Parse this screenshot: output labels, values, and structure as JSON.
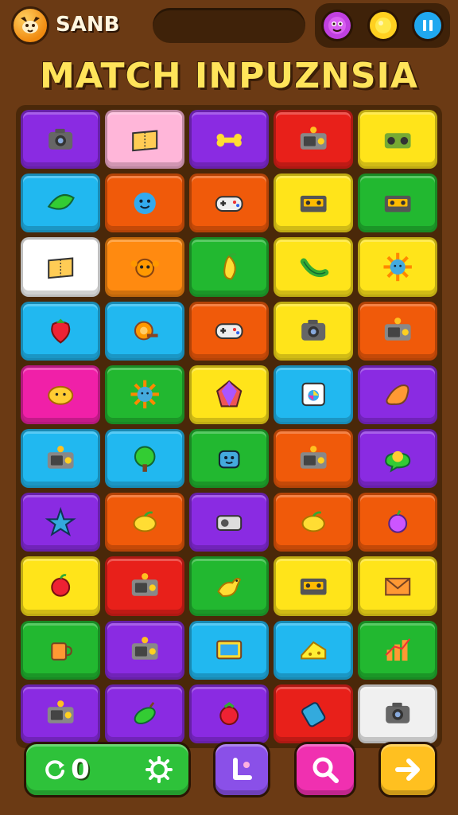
{
  "header": {
    "player_name": "SANB",
    "title": "MATCH INPUZNSIA",
    "icons": [
      "fox-logo-icon",
      "purple-creature-icon",
      "yellow-coin-icon",
      "pause-icon"
    ]
  },
  "board": {
    "tiles": [
      {
        "color": "#8a2be2",
        "icon": "camera-icon"
      },
      {
        "color": "#ffb6d9",
        "icon": "ticket-icon"
      },
      {
        "color": "#8a2be2",
        "icon": "bone-icon"
      },
      {
        "color": "#e8201a",
        "icon": "radio-icon"
      },
      {
        "color": "#ffe41a",
        "icon": "boombox-icon"
      },
      {
        "color": "#21b8f0",
        "icon": "leaf-icon"
      },
      {
        "color": "#f05a0a",
        "icon": "smiley-ball-icon"
      },
      {
        "color": "#f05a0a",
        "icon": "gamepad-icon"
      },
      {
        "color": "#ffe41a",
        "icon": "cassette-icon"
      },
      {
        "color": "#22b830",
        "icon": "cassette-icon"
      },
      {
        "color": "#ffffff",
        "icon": "ticket-icon"
      },
      {
        "color": "#ff8a10",
        "icon": "crab-icon"
      },
      {
        "color": "#22b830",
        "icon": "mango-icon"
      },
      {
        "color": "#ffe41a",
        "icon": "cucumber-icon"
      },
      {
        "color": "#ffe41a",
        "icon": "sun-face-icon"
      },
      {
        "color": "#21b8f0",
        "icon": "strawberry-icon"
      },
      {
        "color": "#21b8f0",
        "icon": "gear-icon"
      },
      {
        "color": "#f05a0a",
        "icon": "gamepad-icon"
      },
      {
        "color": "#ffe41a",
        "icon": "camera-icon"
      },
      {
        "color": "#f05a0a",
        "icon": "radio-icon"
      },
      {
        "color": "#f020a8",
        "icon": "smiley-bun-icon"
      },
      {
        "color": "#22b830",
        "icon": "sun-face-icon"
      },
      {
        "color": "#ffe41a",
        "icon": "gem-icon"
      },
      {
        "color": "#21b8f0",
        "icon": "photo-frame-icon"
      },
      {
        "color": "#8a2be2",
        "icon": "splat-icon"
      },
      {
        "color": "#21b8f0",
        "icon": "radio-icon"
      },
      {
        "color": "#21b8f0",
        "icon": "tree-icon"
      },
      {
        "color": "#22b830",
        "icon": "robot-icon"
      },
      {
        "color": "#f05a0a",
        "icon": "radio-icon"
      },
      {
        "color": "#8a2be2",
        "icon": "speech-ball-icon"
      },
      {
        "color": "#8a2be2",
        "icon": "star-icon"
      },
      {
        "color": "#f05a0a",
        "icon": "lemon-icon"
      },
      {
        "color": "#8a2be2",
        "icon": "projector-icon"
      },
      {
        "color": "#f05a0a",
        "icon": "lemon-icon"
      },
      {
        "color": "#f05a0a",
        "icon": "plum-icon"
      },
      {
        "color": "#ffe41a",
        "icon": "apple-icon"
      },
      {
        "color": "#e8201a",
        "icon": "radio-icon"
      },
      {
        "color": "#22b830",
        "icon": "bird-icon"
      },
      {
        "color": "#ffe41a",
        "icon": "cassette-icon"
      },
      {
        "color": "#ffe41a",
        "icon": "envelope-icon"
      },
      {
        "color": "#22b830",
        "icon": "mug-icon"
      },
      {
        "color": "#8a2be2",
        "icon": "radio-icon"
      },
      {
        "color": "#21b8f0",
        "icon": "tablet-icon"
      },
      {
        "color": "#21b8f0",
        "icon": "cheese-icon"
      },
      {
        "color": "#22b830",
        "icon": "chart-icon"
      },
      {
        "color": "#8a2be2",
        "icon": "radio-icon"
      },
      {
        "color": "#8a2be2",
        "icon": "pepper-icon"
      },
      {
        "color": "#8a2be2",
        "icon": "tomato-icon"
      },
      {
        "color": "#e8201a",
        "icon": "can-icon"
      },
      {
        "color": "#f0f0f0",
        "icon": "camera-icon"
      }
    ]
  },
  "bottom_bar": {
    "hint_label": "0",
    "buttons": [
      "hint-button",
      "settings-button",
      "undo-button",
      "search-button",
      "next-button"
    ]
  }
}
